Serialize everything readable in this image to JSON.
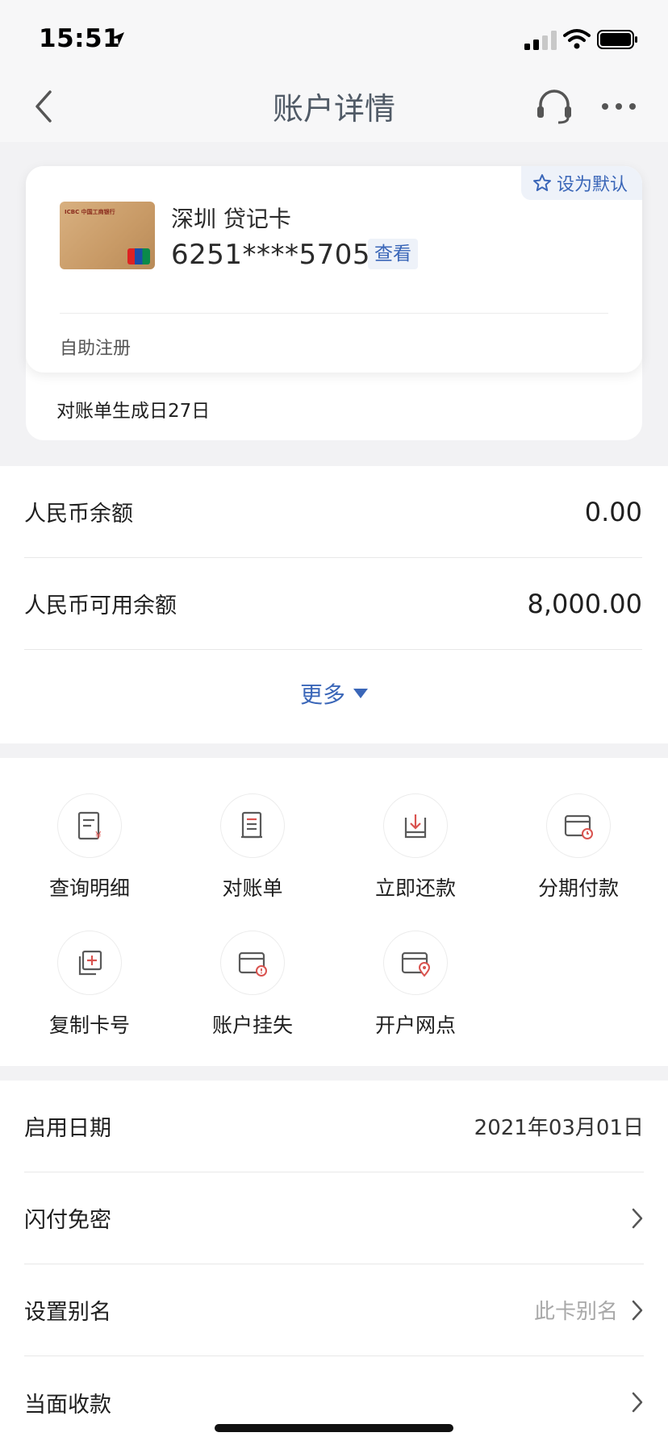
{
  "status_bar": {
    "time": "15:51"
  },
  "nav": {
    "title": "账户详情"
  },
  "card": {
    "set_default_label": "设为默认",
    "name": "深圳 贷记卡",
    "number": "6251****5705",
    "view_label": "查看",
    "registration": "自助注册",
    "statement_day": "对账单生成日27日",
    "card_logo_text": "ICBC 中国工商银行"
  },
  "balances": [
    {
      "label": "人民币余额",
      "amount": "0.00"
    },
    {
      "label": "人民币可用余额",
      "amount": "8,000.00"
    }
  ],
  "more_label": "更多",
  "actions": [
    {
      "label": "查询明细",
      "icon": "detail-query-icon"
    },
    {
      "label": "对账单",
      "icon": "statement-icon"
    },
    {
      "label": "立即还款",
      "icon": "repay-icon"
    },
    {
      "label": "分期付款",
      "icon": "installment-icon"
    },
    {
      "label": "复制卡号",
      "icon": "copy-icon"
    },
    {
      "label": "账户挂失",
      "icon": "report-loss-icon"
    },
    {
      "label": "开户网点",
      "icon": "branch-location-icon"
    }
  ],
  "info": [
    {
      "label": "启用日期",
      "value": "2021年03月01日"
    },
    {
      "label": "闪付免密",
      "value": ""
    },
    {
      "label": "设置别名",
      "hint": "此卡别名"
    },
    {
      "label": "当面收款",
      "value": ""
    }
  ],
  "colors": {
    "accent": "#3a66b8",
    "icon_red": "#d9534f",
    "icon_gray": "#5a5a5a"
  }
}
